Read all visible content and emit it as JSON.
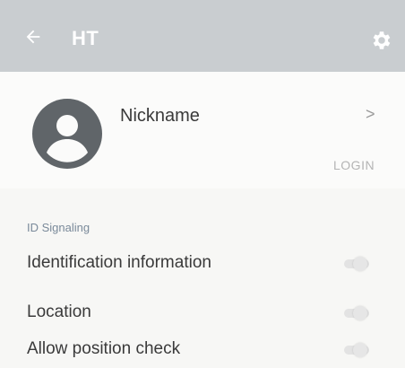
{
  "colors": {
    "appbar": "#c9cdd0",
    "section_header": "#7a8a9a",
    "avatar": "#606569"
  },
  "appbar": {
    "back_icon": "arrow-left-icon",
    "title": "HT",
    "settings_icon": "gear-icon"
  },
  "profile": {
    "avatar_icon": "user-avatar-icon",
    "nickname": "Nickname",
    "chevron": ">",
    "login_label": "LOGIN"
  },
  "section": {
    "header": "ID Signaling",
    "items": [
      {
        "label": "Identification information"
      },
      {
        "label": "Location"
      },
      {
        "label": "Allow position check"
      }
    ]
  }
}
